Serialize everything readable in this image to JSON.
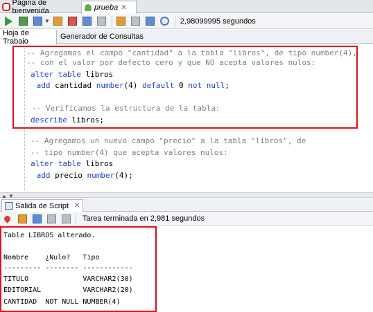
{
  "doc_tabs": [
    {
      "label": "Página de bienvenida"
    },
    {
      "label": "prueba"
    }
  ],
  "toolbar": {
    "elapsed": "2,98099995 segundos"
  },
  "sub_tabs": [
    {
      "label": "Hoja de Trabajo"
    },
    {
      "label": "Generador de Consultas"
    }
  ],
  "editor": {
    "lines": [
      [
        {
          "t": "cm",
          "s": "-- Agregamos el campo \"cantidad\" a la tabla \"libros\", de tipo number(4),"
        }
      ],
      [
        {
          "t": "cm",
          "s": "-- con el valor por defecto cero y que NO acepta valores nulos:"
        }
      ],
      [
        {
          "t": "kw",
          "s": "alter table"
        },
        {
          "t": "tx",
          "s": " libros"
        }
      ],
      [
        {
          "t": "tx",
          "s": " "
        },
        {
          "t": "kw",
          "s": "add"
        },
        {
          "t": "tx",
          "s": " cantidad "
        },
        {
          "t": "kw",
          "s": "number"
        },
        {
          "t": "tx",
          "s": "(4) "
        },
        {
          "t": "kw",
          "s": "default"
        },
        {
          "t": "tx",
          "s": " 0 "
        },
        {
          "t": "kw",
          "s": "not null"
        },
        {
          "t": "tx",
          "s": ";"
        }
      ],
      [
        {
          "t": "tx",
          "s": ""
        }
      ],
      [
        {
          "t": "cm",
          "s": "-- Verificamos la estructura de la tabla:"
        }
      ],
      [
        {
          "t": "kw",
          "s": "describe"
        },
        {
          "t": "tx",
          "s": " libros;"
        }
      ],
      [
        {
          "t": "tx",
          "s": ""
        }
      ],
      [
        {
          "t": "cm",
          "s": "-- Agregamos un nuevo campo \"precio\" a la tabla \"libros\", de"
        }
      ],
      [
        {
          "t": "cm",
          "s": "-- tipo number(4) que acepta valores nulos:"
        }
      ],
      [
        {
          "t": "kw",
          "s": "alter table"
        },
        {
          "t": "tx",
          "s": " libros"
        }
      ],
      [
        {
          "t": "tx",
          "s": " "
        },
        {
          "t": "kw",
          "s": "add"
        },
        {
          "t": "tx",
          "s": " precio "
        },
        {
          "t": "kw",
          "s": "number"
        },
        {
          "t": "tx",
          "s": "(4);"
        }
      ]
    ]
  },
  "output_tab": {
    "label": "Salida de Script"
  },
  "output_toolbar": {
    "status": "Tarea terminada en 2,981 segundos"
  },
  "output": {
    "lines": [
      "Table LIBROS alterado.",
      "",
      "Nombre    ¿Nulo?   Tipo",
      "--------- -------- ------------",
      "TITULO             VARCHAR2(30)",
      "EDITORIAL          VARCHAR2(20)",
      "CANTIDAD  NOT NULL NUMBER(4)"
    ]
  },
  "colors": {
    "comment": "#808080",
    "keyword": "#1c3fd4",
    "highlight": "#e0101c"
  }
}
